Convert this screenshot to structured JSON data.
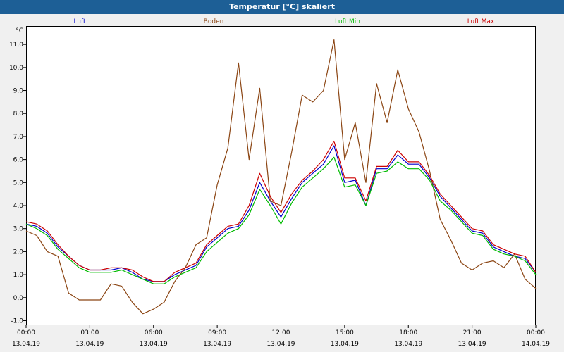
{
  "window": {
    "title": "Temperatur [°C] skaliert"
  },
  "chart_data": {
    "type": "line",
    "title": "Temperatur [°C] skaliert",
    "ylabel": "°C",
    "ylim": [
      -1.2,
      11.8
    ],
    "yticks": [
      "-1,0",
      "0,0",
      "1,0",
      "2,0",
      "3,0",
      "4,0",
      "5,0",
      "6,0",
      "7,0",
      "8,0",
      "9,0",
      "10,0",
      "11,0"
    ],
    "ytick_values": [
      -1,
      0,
      1,
      2,
      3,
      4,
      5,
      6,
      7,
      8,
      9,
      10,
      11
    ],
    "xlim_hours": [
      0,
      24
    ],
    "xtick_times": [
      "00:00",
      "03:00",
      "06:00",
      "09:00",
      "12:00",
      "15:00",
      "18:00",
      "21:00",
      "00:00"
    ],
    "xtick_dates": [
      "13.04.19",
      "13.04.19",
      "13.04.19",
      "13.04.19",
      "13.04.19",
      "13.04.19",
      "13.04.19",
      "13.04.19",
      "14.04.19"
    ],
    "grid": true,
    "legend_position": "top",
    "x_hours": [
      0,
      0.5,
      1,
      1.5,
      2,
      2.5,
      3,
      3.5,
      4,
      4.5,
      5,
      5.5,
      6,
      6.5,
      7,
      7.5,
      8,
      8.5,
      9,
      9.5,
      10,
      10.5,
      11,
      11.5,
      12,
      12.5,
      13,
      13.5,
      14,
      14.5,
      15,
      15.5,
      16,
      16.5,
      17,
      17.5,
      18,
      18.5,
      19,
      19.5,
      20,
      20.5,
      21,
      21.5,
      22,
      22.5,
      23,
      23.5,
      24
    ],
    "series": [
      {
        "name": "Luft",
        "color": "#0000cc",
        "values": [
          3.2,
          3.1,
          2.8,
          2.2,
          1.8,
          1.4,
          1.2,
          1.2,
          1.2,
          1.3,
          1.1,
          0.8,
          0.7,
          0.7,
          1.0,
          1.2,
          1.4,
          2.2,
          2.6,
          3.0,
          3.1,
          3.8,
          5.0,
          4.2,
          3.5,
          4.3,
          5.0,
          5.4,
          5.8,
          6.6,
          5.0,
          5.1,
          4.0,
          5.6,
          5.6,
          6.2,
          5.8,
          5.8,
          5.2,
          4.4,
          3.9,
          3.4,
          2.9,
          2.8,
          2.2,
          2.0,
          1.8,
          1.7,
          1.1
        ]
      },
      {
        "name": "Boden",
        "color": "#8b4513",
        "values": [
          2.9,
          2.7,
          2.0,
          1.8,
          0.2,
          -0.1,
          -0.1,
          -0.1,
          0.6,
          0.5,
          -0.2,
          -0.7,
          -0.5,
          -0.2,
          0.7,
          1.3,
          2.3,
          2.6,
          4.9,
          6.5,
          10.2,
          6.0,
          9.1,
          4.2,
          4.0,
          6.3,
          8.8,
          8.5,
          9.0,
          11.2,
          6.0,
          7.6,
          5.0,
          9.3,
          7.6,
          9.9,
          8.2,
          7.2,
          5.5,
          3.4,
          2.5,
          1.5,
          1.2,
          1.5,
          1.6,
          1.3,
          1.9,
          0.8,
          0.4
        ]
      },
      {
        "name": "Luft Min",
        "color": "#00bb00",
        "values": [
          3.2,
          3.0,
          2.7,
          2.1,
          1.7,
          1.3,
          1.1,
          1.1,
          1.1,
          1.2,
          1.0,
          0.8,
          0.6,
          0.6,
          0.9,
          1.1,
          1.3,
          2.0,
          2.4,
          2.8,
          3.0,
          3.6,
          4.7,
          4.0,
          3.2,
          4.1,
          4.8,
          5.2,
          5.6,
          6.1,
          4.8,
          4.9,
          4.0,
          5.4,
          5.5,
          5.9,
          5.6,
          5.6,
          5.1,
          4.2,
          3.8,
          3.3,
          2.8,
          2.7,
          2.1,
          1.9,
          1.8,
          1.6,
          1.0
        ]
      },
      {
        "name": "Luft Max",
        "color": "#cc0000",
        "values": [
          3.3,
          3.2,
          2.9,
          2.3,
          1.8,
          1.4,
          1.2,
          1.2,
          1.3,
          1.3,
          1.2,
          0.9,
          0.7,
          0.7,
          1.1,
          1.3,
          1.5,
          2.3,
          2.7,
          3.1,
          3.2,
          4.0,
          5.4,
          4.4,
          3.7,
          4.5,
          5.1,
          5.5,
          6.0,
          6.8,
          5.2,
          5.2,
          4.2,
          5.7,
          5.7,
          6.4,
          5.9,
          5.9,
          5.3,
          4.5,
          4.0,
          3.5,
          3.0,
          2.9,
          2.3,
          2.1,
          1.9,
          1.8,
          1.1
        ]
      }
    ]
  }
}
